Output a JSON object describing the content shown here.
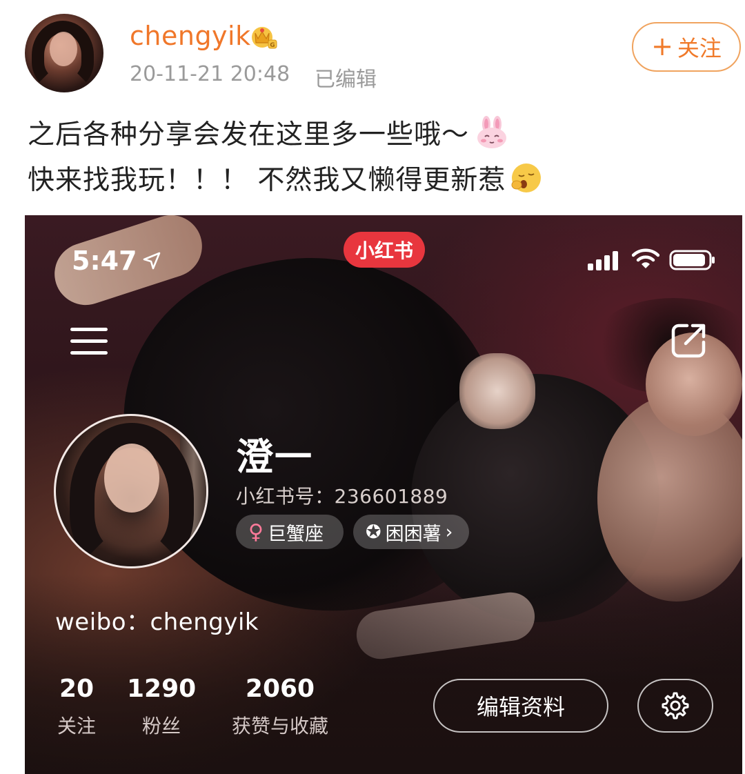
{
  "post": {
    "username": "chengyik",
    "timestamp": "20-11-21 20:48",
    "edited_label": "已编辑",
    "follow_label": "关注",
    "follow_plus": "+",
    "text_line1": "之后各种分享会发在这里多一些哦～",
    "text_line2": "快来找我玩！！！ 不然我又懒得更新惹",
    "badge_icon": "crown-icon",
    "accent_color": "#f0772a"
  },
  "screenshot": {
    "status_time": "5:47",
    "app_badge": "小红书",
    "icons": [
      "location-arrow-icon",
      "signal-bars-icon",
      "wifi-icon",
      "battery-icon",
      "menu-icon",
      "share-icon",
      "settings-gear-icon"
    ],
    "profile": {
      "nickname": "澄一",
      "id_text": "小红书号：236601889",
      "tags": [
        {
          "symbol": "♀",
          "label": "巨蟹座"
        },
        {
          "symbol": "✪",
          "label": "困困薯",
          "chevron": "›"
        }
      ],
      "bio": "weibo：chengyik",
      "stats": [
        {
          "value": "20",
          "label": "关注"
        },
        {
          "value": "1290",
          "label": "粉丝"
        },
        {
          "value": "2060",
          "label": "获赞与收藏"
        }
      ],
      "edit_button_label": "编辑资料"
    }
  }
}
